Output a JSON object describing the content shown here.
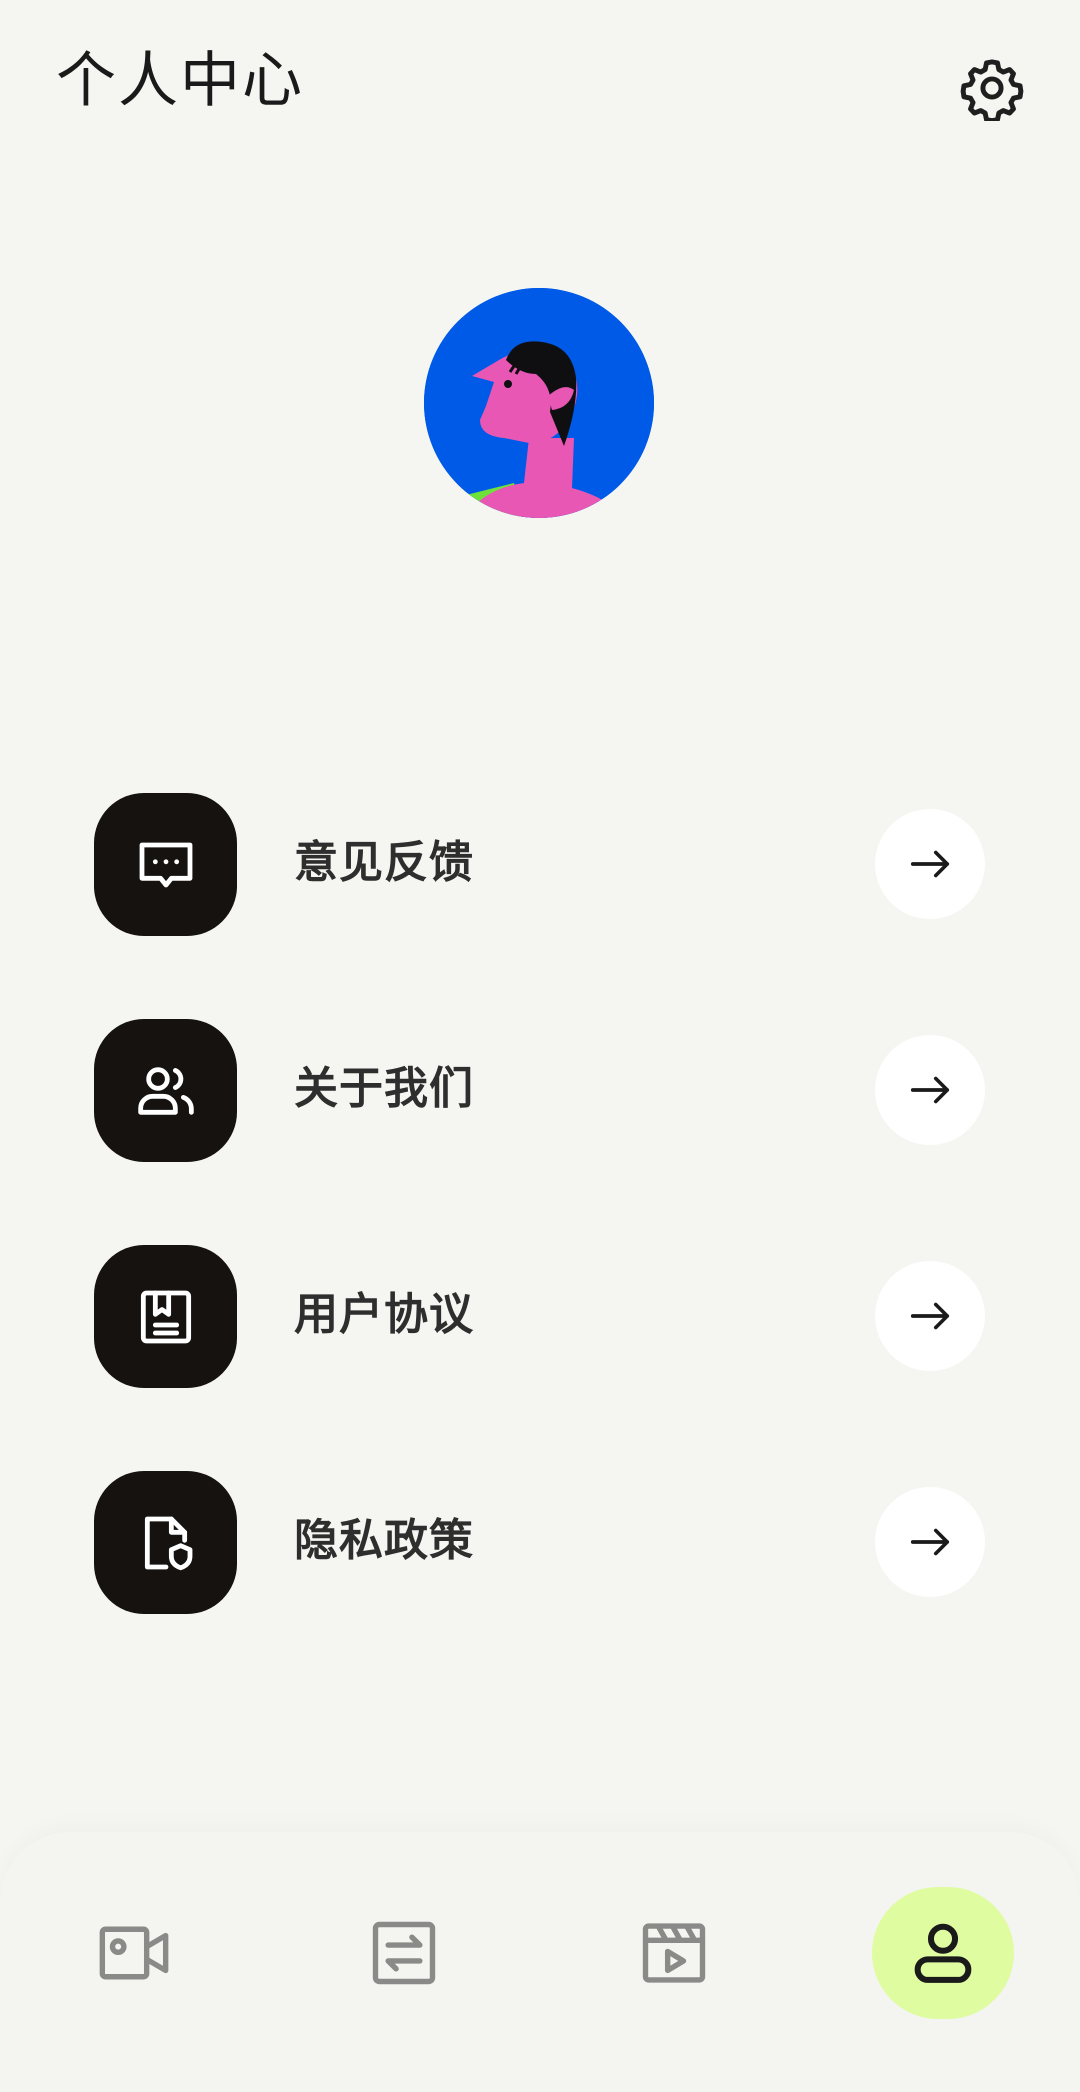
{
  "header": {
    "title": "个人中心",
    "settings_icon": "gear-icon"
  },
  "profile": {
    "avatar_icon": "user-illustration-avatar"
  },
  "menu": [
    {
      "label": "意见反馈",
      "icon": "chat-bubble-icon"
    },
    {
      "label": "关于我们",
      "icon": "users-icon"
    },
    {
      "label": "用户协议",
      "icon": "document-bookmark-icon"
    },
    {
      "label": "隐私政策",
      "icon": "file-shield-icon"
    }
  ],
  "tabbar": {
    "tabs": [
      {
        "icon": "video-camera-icon",
        "active": false
      },
      {
        "icon": "swap-icon",
        "active": false
      },
      {
        "icon": "clapperboard-play-icon",
        "active": false
      },
      {
        "icon": "user-icon",
        "active": true
      }
    ]
  },
  "colors": {
    "background": "#f5f5f1",
    "icon_box": "#151210",
    "active_tab": "#dffca0",
    "avatar_bg": "#005ae8",
    "avatar_skin": "#e857b4"
  }
}
